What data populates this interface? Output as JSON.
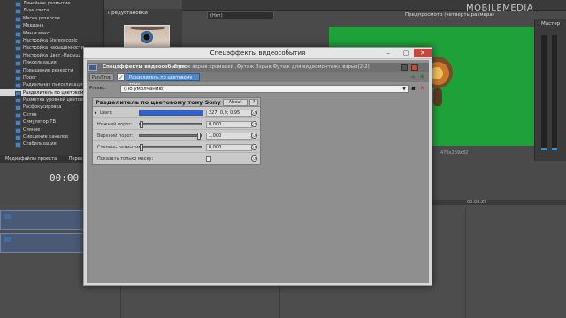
{
  "tree": {
    "items": [
      "Линейное размытие",
      "Лучи света",
      "Маска резкости",
      "Медиана",
      "Мин и макс",
      "Настройка Stereoscopic",
      "Настройка насыщенности",
      "Настройка Цвет.-Насыщ.",
      "Пикселизация",
      "Повышение резкости",
      "Порог",
      "Радиальная пикселизация",
      "Разделитель по цветовому",
      "Разметка уровней цветов",
      "Расфокусировка",
      "Сетка",
      "Симулятор ТВ",
      "Сияние",
      "Смещение каналов",
      "Стабилизация"
    ],
    "selected_index": 12
  },
  "preview_panel": {
    "title": "Предустановки"
  },
  "combo": {
    "value": "(Нет)"
  },
  "preview_window": {
    "label": "Предпросмотр (четверть размера)"
  },
  "watermark": "MOBILEMEDIA",
  "master": {
    "label": "Мастер"
  },
  "status": {
    "frame": "68",
    "size": "470x269x32"
  },
  "bottom_tabs": [
    "Медиафайлы проекта",
    "Переходы"
  ],
  "timecode": "00:00",
  "ruler": {
    "label": "00:00:29"
  },
  "dialog": {
    "title": "Спецэффекты видеособытия",
    "chain_label": "Спецэффекты видеособытия:",
    "chain_rest": "Футаж взрыв хромакей ,Футаж Взрыв,Футаж для видеомонтажа взрыв(2-2)",
    "pan_crop": "Pan/Crop",
    "active_fx": "Разделитель по цветовому тону",
    "preset_label": "Preset:",
    "preset_value": "(По умолчанию)",
    "plugin": {
      "title": "Разделитель по цветовому тону Sony",
      "about": "About",
      "help": "?",
      "params": {
        "color": {
          "label": "Цвет:",
          "value": "227; 0,9; 0,95"
        },
        "lower": {
          "label": "Нижний порог:",
          "value": "0,000",
          "level": 0.0
        },
        "upper": {
          "label": "Верхний порог:",
          "value": "1,000",
          "level": 1.0
        },
        "blur": {
          "label": "Степень размытия:",
          "value": "0,000",
          "level": 0.0
        },
        "mask": {
          "label": "Показать только маску:"
        }
      }
    }
  },
  "colors": {
    "accent": "#4d88c8",
    "hue_color": "#2b62d8",
    "green_screen": "#1fa13a"
  }
}
